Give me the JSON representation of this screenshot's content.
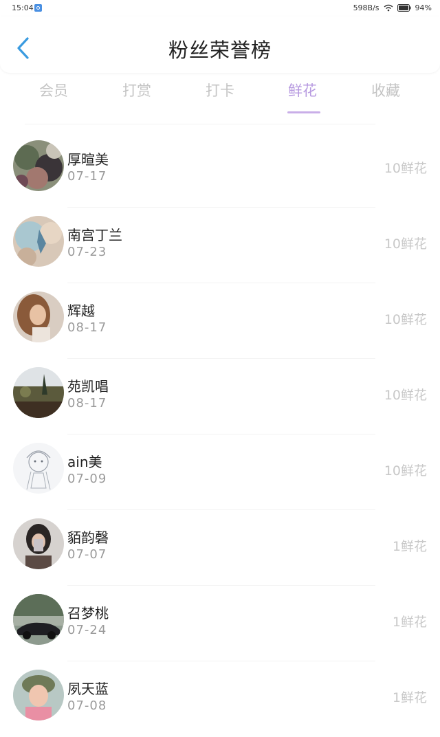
{
  "status_bar": {
    "time": "15:04",
    "network_speed": "598B/s",
    "battery": "94%"
  },
  "header": {
    "title": "粉丝荣誉榜"
  },
  "tabs": [
    {
      "label": "会员",
      "active": false
    },
    {
      "label": "打赏",
      "active": false
    },
    {
      "label": "打卡",
      "active": false
    },
    {
      "label": "鲜花",
      "active": true
    },
    {
      "label": "收藏",
      "active": false
    }
  ],
  "colors": {
    "accent": "#b79ae0",
    "back_arrow": "#3a9be0",
    "muted_text": "#c8c8c8"
  },
  "fans": [
    {
      "name": "厚暄美",
      "date": "07-17",
      "flowers": "10鲜花"
    },
    {
      "name": "南宫丁兰",
      "date": "07-23",
      "flowers": "10鲜花"
    },
    {
      "name": "辉越",
      "date": "08-17",
      "flowers": "10鲜花"
    },
    {
      "name": "苑凯唱",
      "date": "08-17",
      "flowers": "10鲜花"
    },
    {
      "name": "ain美",
      "date": "07-09",
      "flowers": "10鲜花"
    },
    {
      "name": "貊韵磬",
      "date": "07-07",
      "flowers": "1鲜花"
    },
    {
      "name": "召梦桃",
      "date": "07-24",
      "flowers": "1鲜花"
    },
    {
      "name": "夙天蓝",
      "date": "07-08",
      "flowers": "1鲜花"
    }
  ]
}
